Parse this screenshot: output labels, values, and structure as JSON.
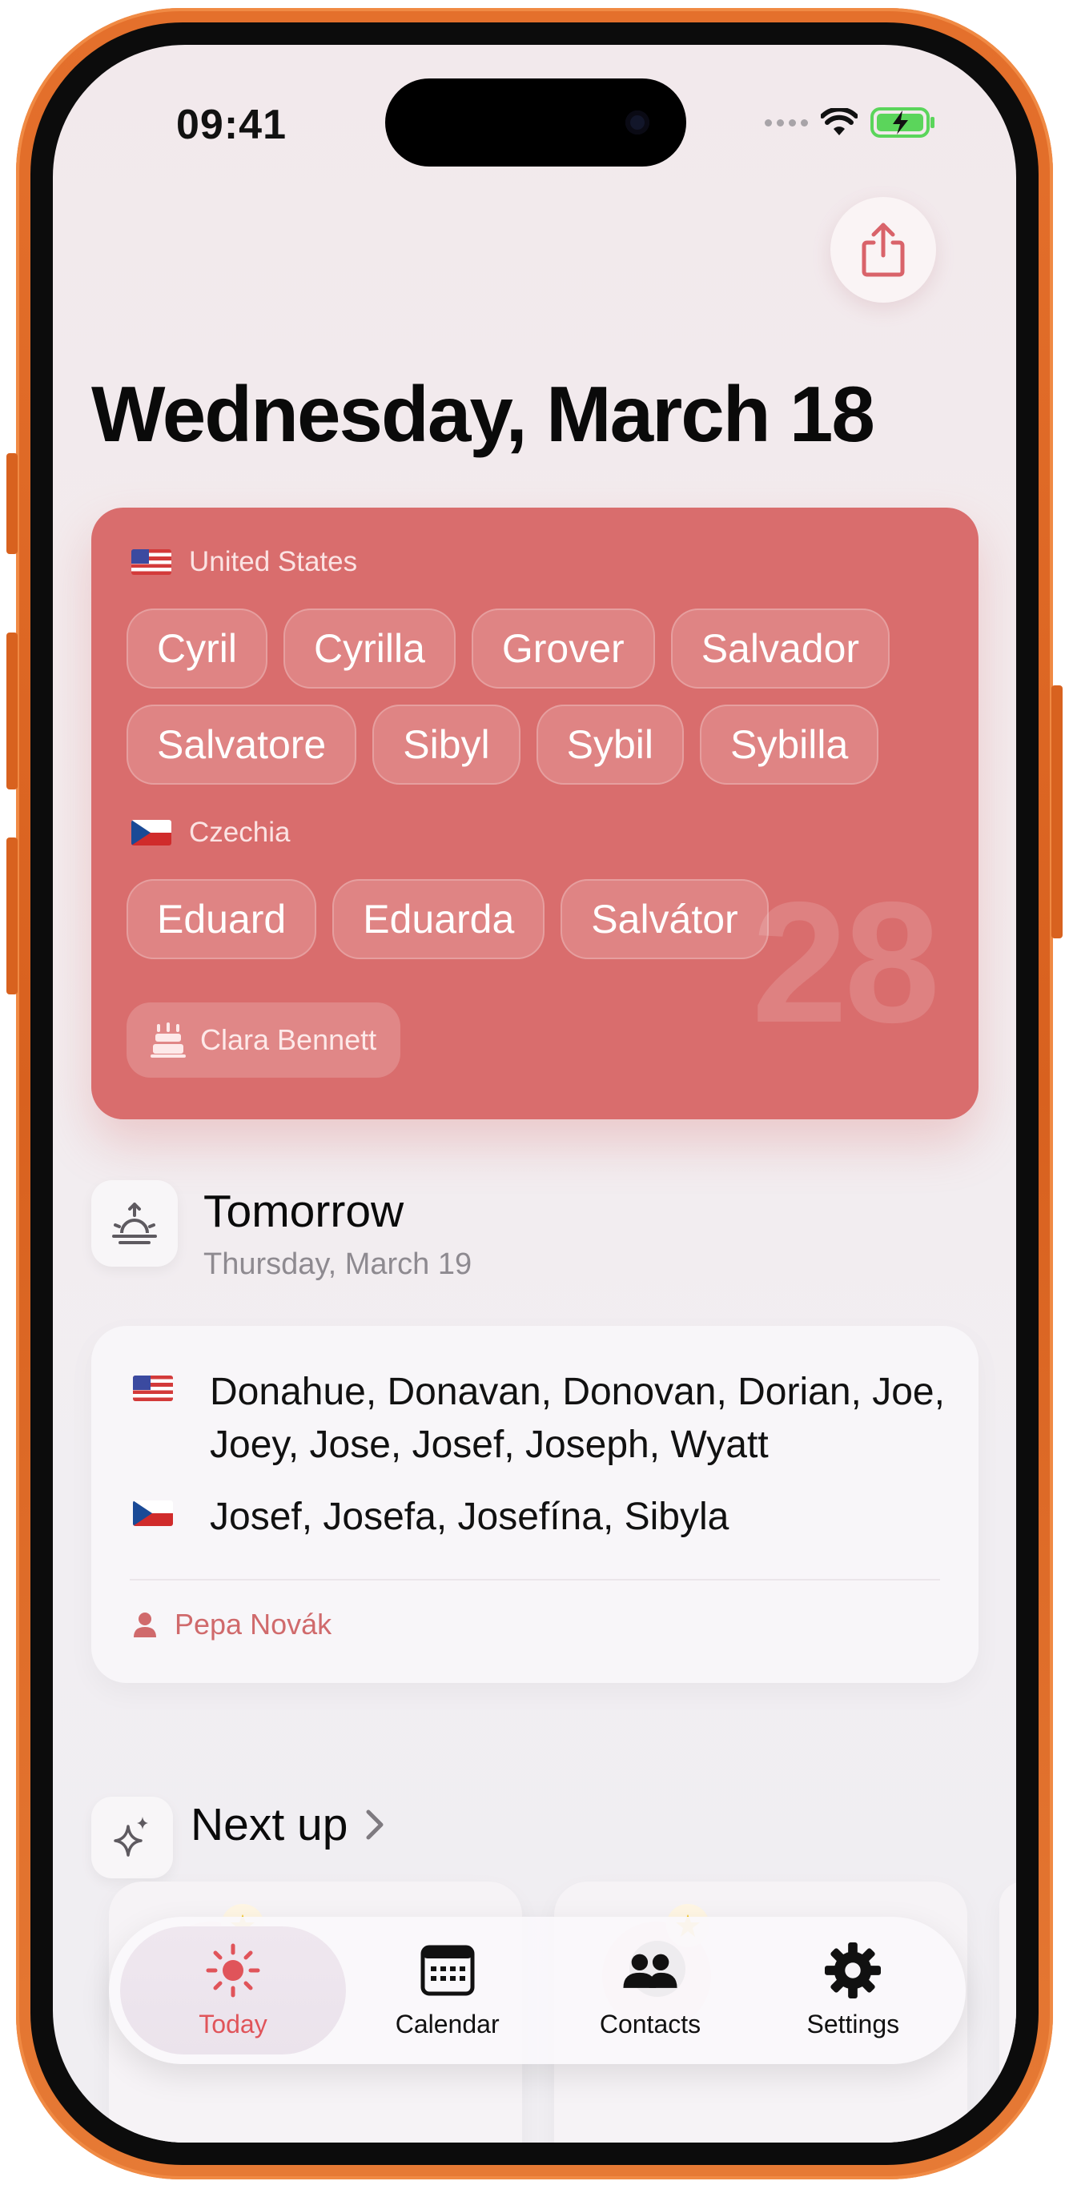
{
  "status_bar": {
    "time": "09:41"
  },
  "page_title": "Wednesday, March 18",
  "today": {
    "groups": [
      {
        "country": "United States",
        "flag": "flag-us-icon",
        "names": [
          "Cyril",
          "Cyrilla",
          "Grover",
          "Salvador",
          "Salvatore",
          "Sibyl",
          "Sybil",
          "Sybilla"
        ]
      },
      {
        "country": "Czechia",
        "flag": "flag-cz-icon",
        "names": [
          "Eduard",
          "Eduarda",
          "Salvátor"
        ]
      }
    ],
    "birthday_contact": "Clara Bennett",
    "day_number": "28",
    "card_color": "#d96d6d"
  },
  "tomorrow": {
    "title": "Tomorrow",
    "date": "Thursday, March 19",
    "us_names": "Donahue, Donavan, Donovan, Dorian, Joe, Joey, Jose, Josef, Joseph, Wyatt",
    "cz_names": "Josef, Josefa, Josefína, Sibyla",
    "contact": "Pepa Novák"
  },
  "next_up": {
    "title": "Next up"
  },
  "tabs": [
    {
      "label": "Today",
      "icon": "sun-icon",
      "active": true
    },
    {
      "label": "Calendar",
      "icon": "calendar-icon",
      "active": false
    },
    {
      "label": "Contacts",
      "icon": "contacts-icon",
      "active": false
    },
    {
      "label": "Settings",
      "icon": "gear-icon",
      "active": false
    }
  ],
  "colors": {
    "accent": "#e0545a",
    "frame": "#e0702c"
  }
}
